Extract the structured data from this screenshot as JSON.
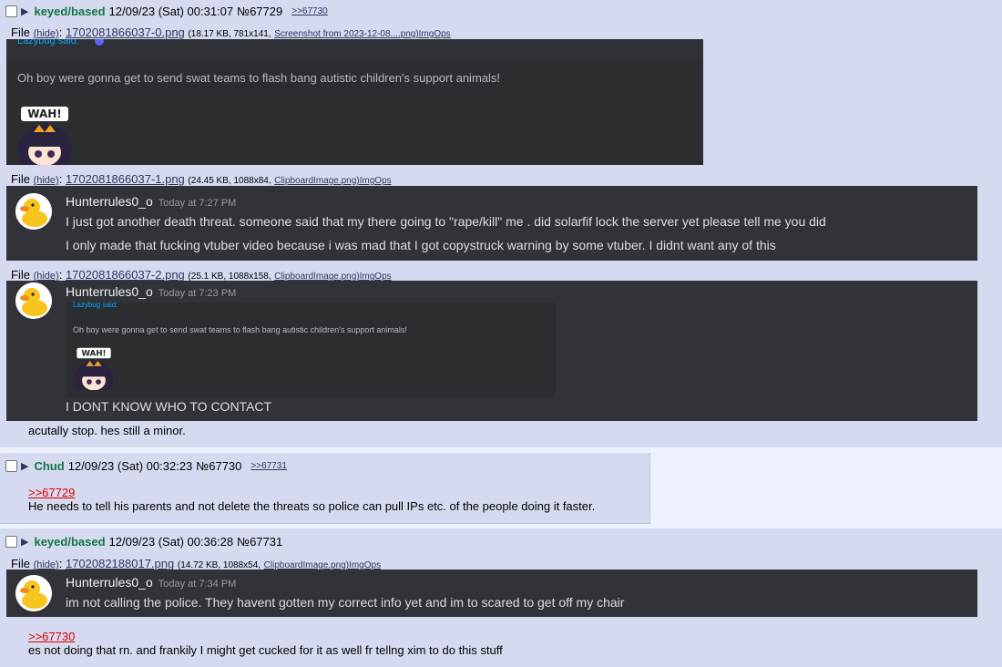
{
  "posts": [
    {
      "name": "keyed/based",
      "date": "12/09/23 (Sat) 00:31:07",
      "no": "№67729",
      "backlink": ">>67730",
      "files": [
        {
          "label": "File",
          "hide": "(hide)",
          "filename": "1702081866037-0.png",
          "meta": "(18.17 KB, 781x141,",
          "source": "Screenshot from 2023-12-08....png)ImgOps",
          "content": {
            "lazy_label": "Lazybug said:",
            "text": "Oh boy were gonna get to send swat teams to flash bang autistic children's support animals!",
            "sticker_text": "WAH!"
          }
        },
        {
          "label": "File",
          "hide": "(hide)",
          "filename": "1702081866037-1.png",
          "meta": "(24.45 KB, 1088x84,",
          "source": "ClipboardImage.png)ImgOps",
          "content": {
            "user": "Hunterrules0_o",
            "time": "Today at 7:27 PM",
            "line1": "I just got another death threat. someone said that my there going to \"rape/kill\" me . did solarfif lock the server yet please tell me you did",
            "line2": "I only made that fucking vtuber video because i was mad that I got copystruck warning by some vtuber. I didnt want any of this"
          }
        },
        {
          "label": "File",
          "hide": "(hide)",
          "filename": "1702081866037-2.png",
          "meta": "(25.1 KB, 1088x158,",
          "source": "ClipboardImage.png)ImgOps",
          "content": {
            "user": "Hunterrules0_o",
            "time": "Today at 7:23 PM",
            "lazy_label": "Lazybug said:",
            "embed_text": "Oh boy were gonna get to send swat teams to flash bang autistic children's support animals!",
            "sticker_text": "WAH!",
            "line1": "I DONT KNOW WHO TO CONTACT"
          }
        }
      ],
      "message": "acutally stop. hes still a minor."
    },
    {
      "name": "Chud",
      "date": "12/09/23 (Sat) 00:32:23",
      "no": "№67730",
      "backlink": ">>67731",
      "quote": ">>67729",
      "message": "He needs to tell his parents and not delete the threats so police can pull IPs etc. of the people doing it faster."
    },
    {
      "name": "keyed/based",
      "date": "12/09/23 (Sat) 00:36:28",
      "no": "№67731",
      "files": [
        {
          "label": "File",
          "hide": "(hide)",
          "filename": "1702082188017.png",
          "meta": "(14.72 KB, 1088x54,",
          "source": "ClipboardImage.png)ImgOps",
          "content": {
            "user": "Hunterrules0_o",
            "time": "Today at 7:34 PM",
            "line1": "im not calling the police. They havent gotten my correct info yet and im to scared to get off my chair"
          }
        }
      ],
      "quote": ">>67730",
      "message": "es not doing that rn. and frankily I might get cucked for it as well fr tellng xim to do this stuff"
    }
  ],
  "colors": {
    "name": "#117743",
    "quote": "#dd0000",
    "post_bg": "#d6daf0",
    "page_bg": "#eef2ff",
    "discord_bg": "#313338"
  }
}
